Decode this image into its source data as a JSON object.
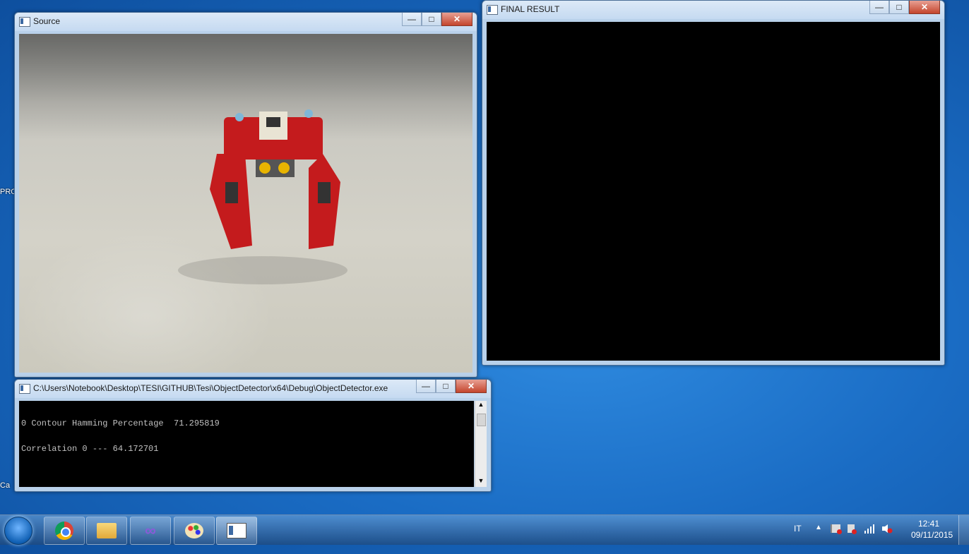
{
  "desktop": {
    "icons": [
      {
        "label": "PRO"
      },
      {
        "label": "Ca"
      }
    ]
  },
  "source_window": {
    "title": "Source",
    "controls": {
      "minimize": "—",
      "maximize": "□",
      "close": "✕"
    }
  },
  "result_window": {
    "title": "FINAL RESULT",
    "controls": {
      "minimize": "—",
      "maximize": "□",
      "close": "✕"
    }
  },
  "console_window": {
    "title": "C:\\Users\\Notebook\\Desktop\\TESI\\GITHUB\\Tesi\\ObjectDetector\\x64\\Debug\\ObjectDetector.exe",
    "controls": {
      "minimize": "—",
      "maximize": "□",
      "close": "✕"
    },
    "lines": [
      "0 Contour Hamming Percentage  71.295819",
      "Correlation 0 --- 64.172701"
    ]
  },
  "taskbar": {
    "apps": [
      {
        "name": "chrome-icon"
      },
      {
        "name": "file-explorer-icon"
      },
      {
        "name": "visual-studio-icon"
      },
      {
        "name": "paint-icon"
      },
      {
        "name": "console-app-icon"
      }
    ],
    "language": "IT",
    "time": "12:41",
    "date": "09/11/2015"
  }
}
